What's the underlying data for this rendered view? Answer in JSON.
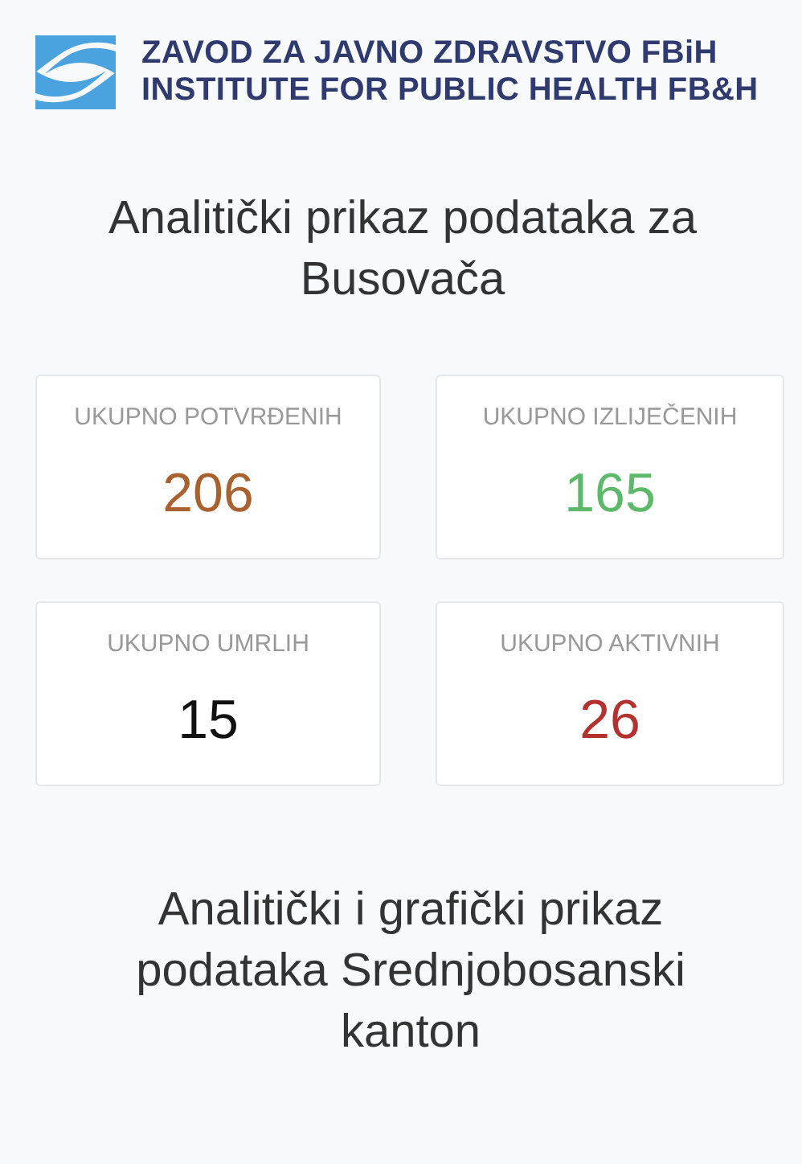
{
  "logo": {
    "line_1": "ZAVOD ZA JAVNO ZDRAVSTVO FBiH",
    "line_2": "INSTITUTE FOR PUBLIC HEALTH FB&H"
  },
  "heading": "Analitički prikaz podataka za Busovača",
  "stats": [
    {
      "label": "UKUPNO POTVRĐENIH",
      "value": "206",
      "color": "#a8612f"
    },
    {
      "label": "UKUPNO IZLIJEČENIH",
      "value": "165",
      "color": "#5cb96a"
    },
    {
      "label": "UKUPNO UMRLIH",
      "value": "15",
      "color": "#111111"
    },
    {
      "label": "UKUPNO AKTIVNIH",
      "value": "26",
      "color": "#b3322f"
    }
  ],
  "subheading": "Analitički i grafički prikaz podataka Srednjobosanski kanton"
}
